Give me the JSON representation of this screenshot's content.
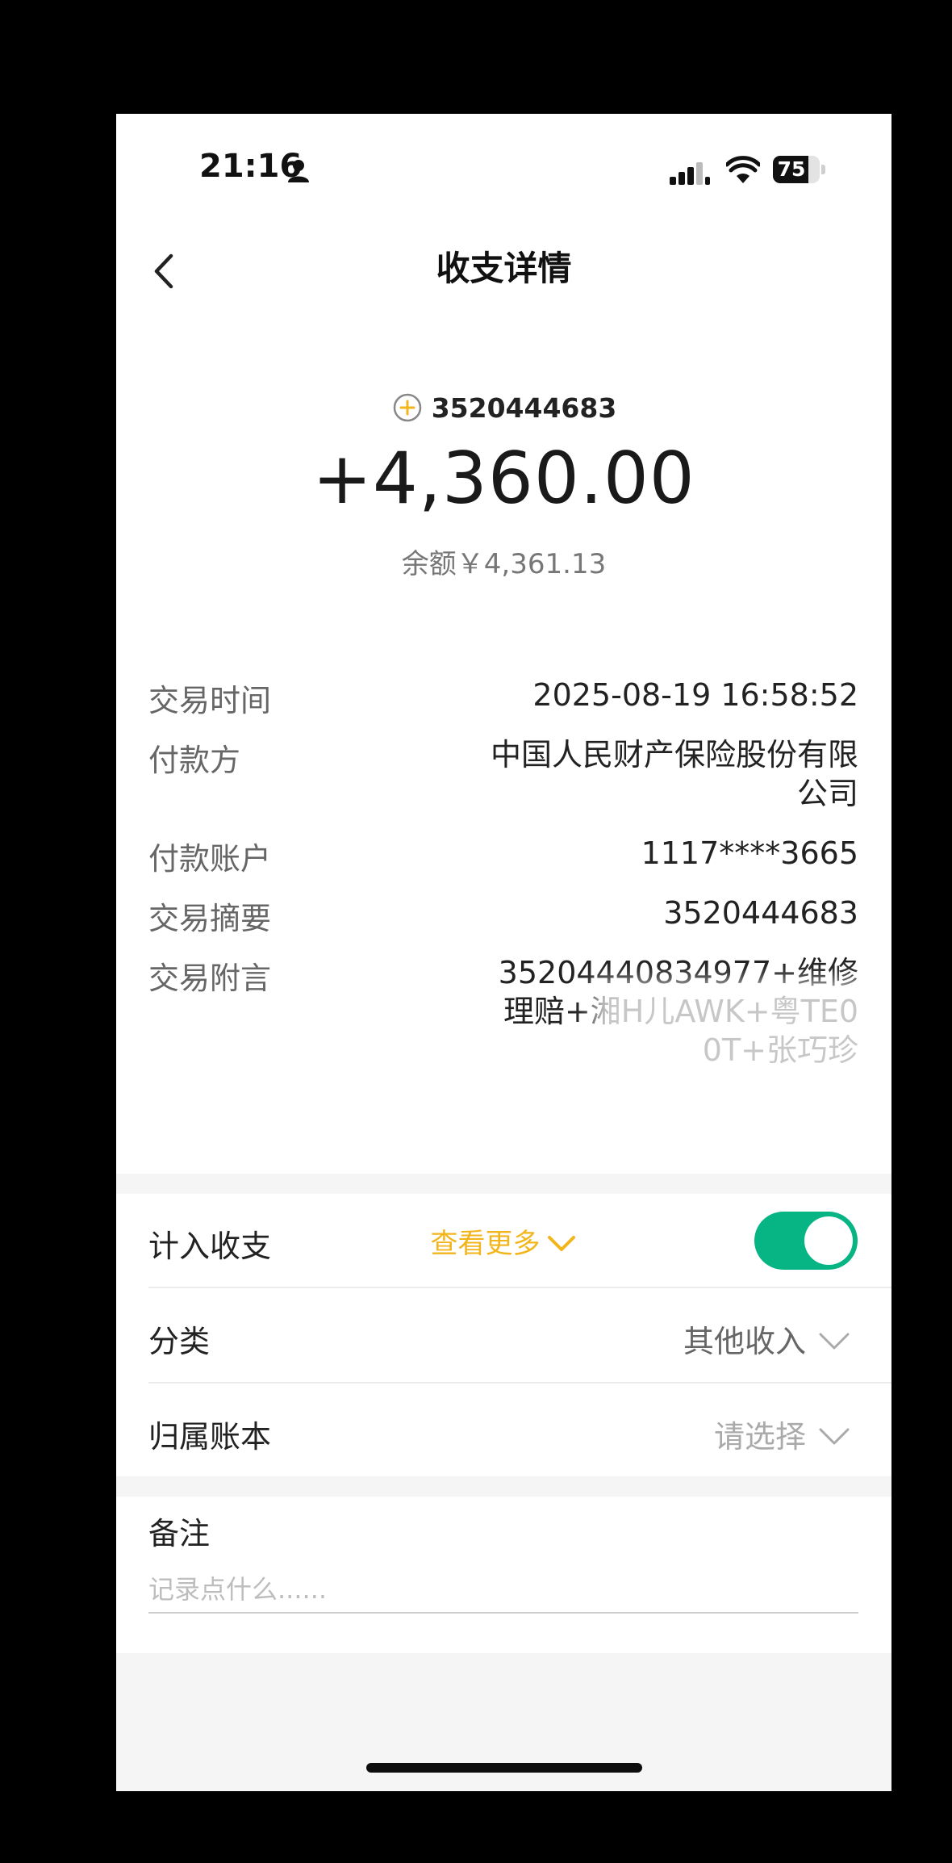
{
  "status_bar": {
    "time": "21:16",
    "battery": "75",
    "battery_level_percent": 75,
    "icons": [
      "person-icon",
      "signal-icon",
      "wifi-icon",
      "battery-icon"
    ]
  },
  "nav": {
    "title": "收支详情",
    "back_icon": "chevron-left-icon"
  },
  "summary": {
    "reference": "3520444683",
    "amount": "+4,360.00",
    "balance": "余额￥4,361.13",
    "coin_icon": "coin-plus-icon",
    "accent_color": "#f2b51c"
  },
  "details": [
    {
      "label": "交易时间",
      "value": "2025-08-19 16:58:52"
    },
    {
      "label": "付款方",
      "value": "中国人民财产保险股份有限公司"
    },
    {
      "label": "付款账户",
      "value": "1117****3665"
    },
    {
      "label": "交易摘要",
      "value": "3520444683"
    },
    {
      "label": "交易附言",
      "value": "35204440834977+维修理赔+湘H儿AWK+粤TE0 0T+张巧珍"
    }
  ],
  "more_label": "查看更多",
  "settings": {
    "include_label": "计入收支",
    "include_enabled": true,
    "toggle_color": "#07b483",
    "category_label": "分类",
    "category_value": "其他收入",
    "ledger_label": "归属账本",
    "ledger_value": "请选择"
  },
  "remark": {
    "label": "备注",
    "placeholder": "记录点什么......"
  }
}
